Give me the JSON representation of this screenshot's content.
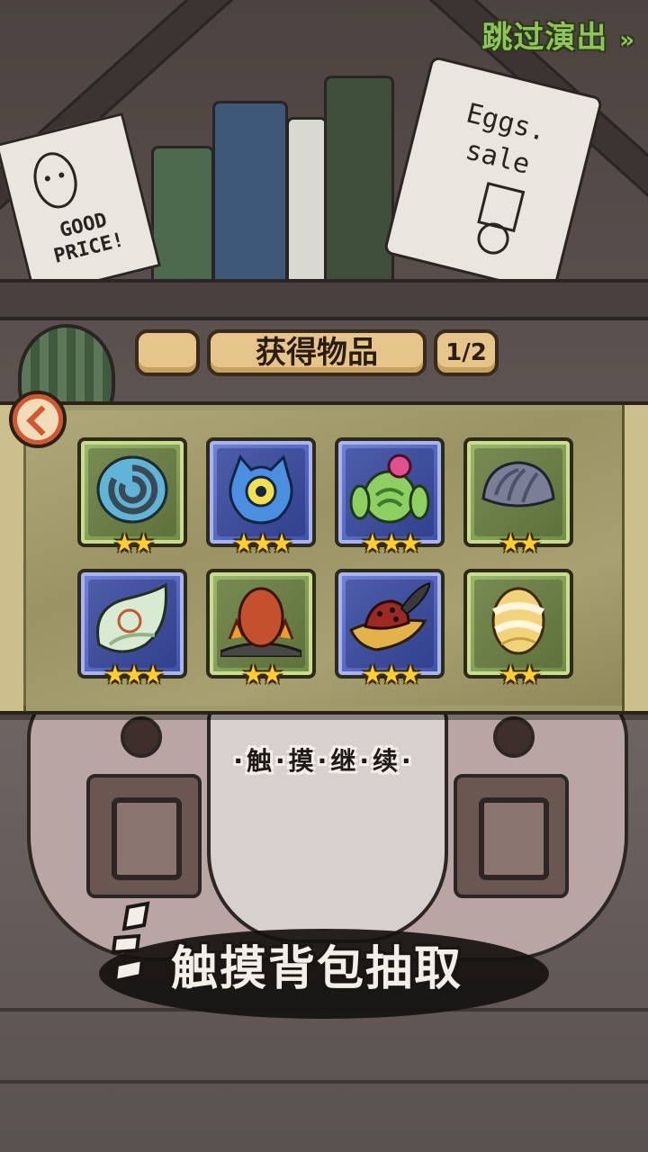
{
  "header": {
    "skip_label": "跳过演出",
    "skip_icon": "double-chevron-right-icon"
  },
  "title_bar": {
    "title": "获得物品",
    "page_counter": "1/2"
  },
  "items": [
    {
      "name": "spiral-shell-egg",
      "rarity_color": "green",
      "stars": 2,
      "stars_text": "★★"
    },
    {
      "name": "blue-eye-blob",
      "rarity_color": "blue",
      "stars": 3,
      "stars_text": "★★★"
    },
    {
      "name": "cactus-flower",
      "rarity_color": "blue",
      "stars": 3,
      "stars_text": "★★★"
    },
    {
      "name": "grey-clam-shell",
      "rarity_color": "green",
      "stars": 2,
      "stars_text": "★★"
    },
    {
      "name": "leaf-wrapped-egg",
      "rarity_color": "blue",
      "stars": 3,
      "stars_text": "★★★"
    },
    {
      "name": "fire-egg-on-coals",
      "rarity_color": "green",
      "stars": 2,
      "stars_text": "★★"
    },
    {
      "name": "feathered-hat",
      "rarity_color": "blue",
      "stars": 3,
      "stars_text": "★★★"
    },
    {
      "name": "bandaged-egg",
      "rarity_color": "green",
      "stars": 2,
      "stars_text": "★★"
    }
  ],
  "continue_label": "·触·摸·继·续·",
  "hint_label": "触摸背包抽取",
  "background_props": {
    "sign_left": "GOOD PRICE!",
    "sign_right": "Eggs. sale"
  },
  "colors": {
    "skip_green": "#8ec45a",
    "rarity_green": "#9ab86c",
    "rarity_blue": "#7083d8",
    "star_gold": "#ffcf2e"
  }
}
